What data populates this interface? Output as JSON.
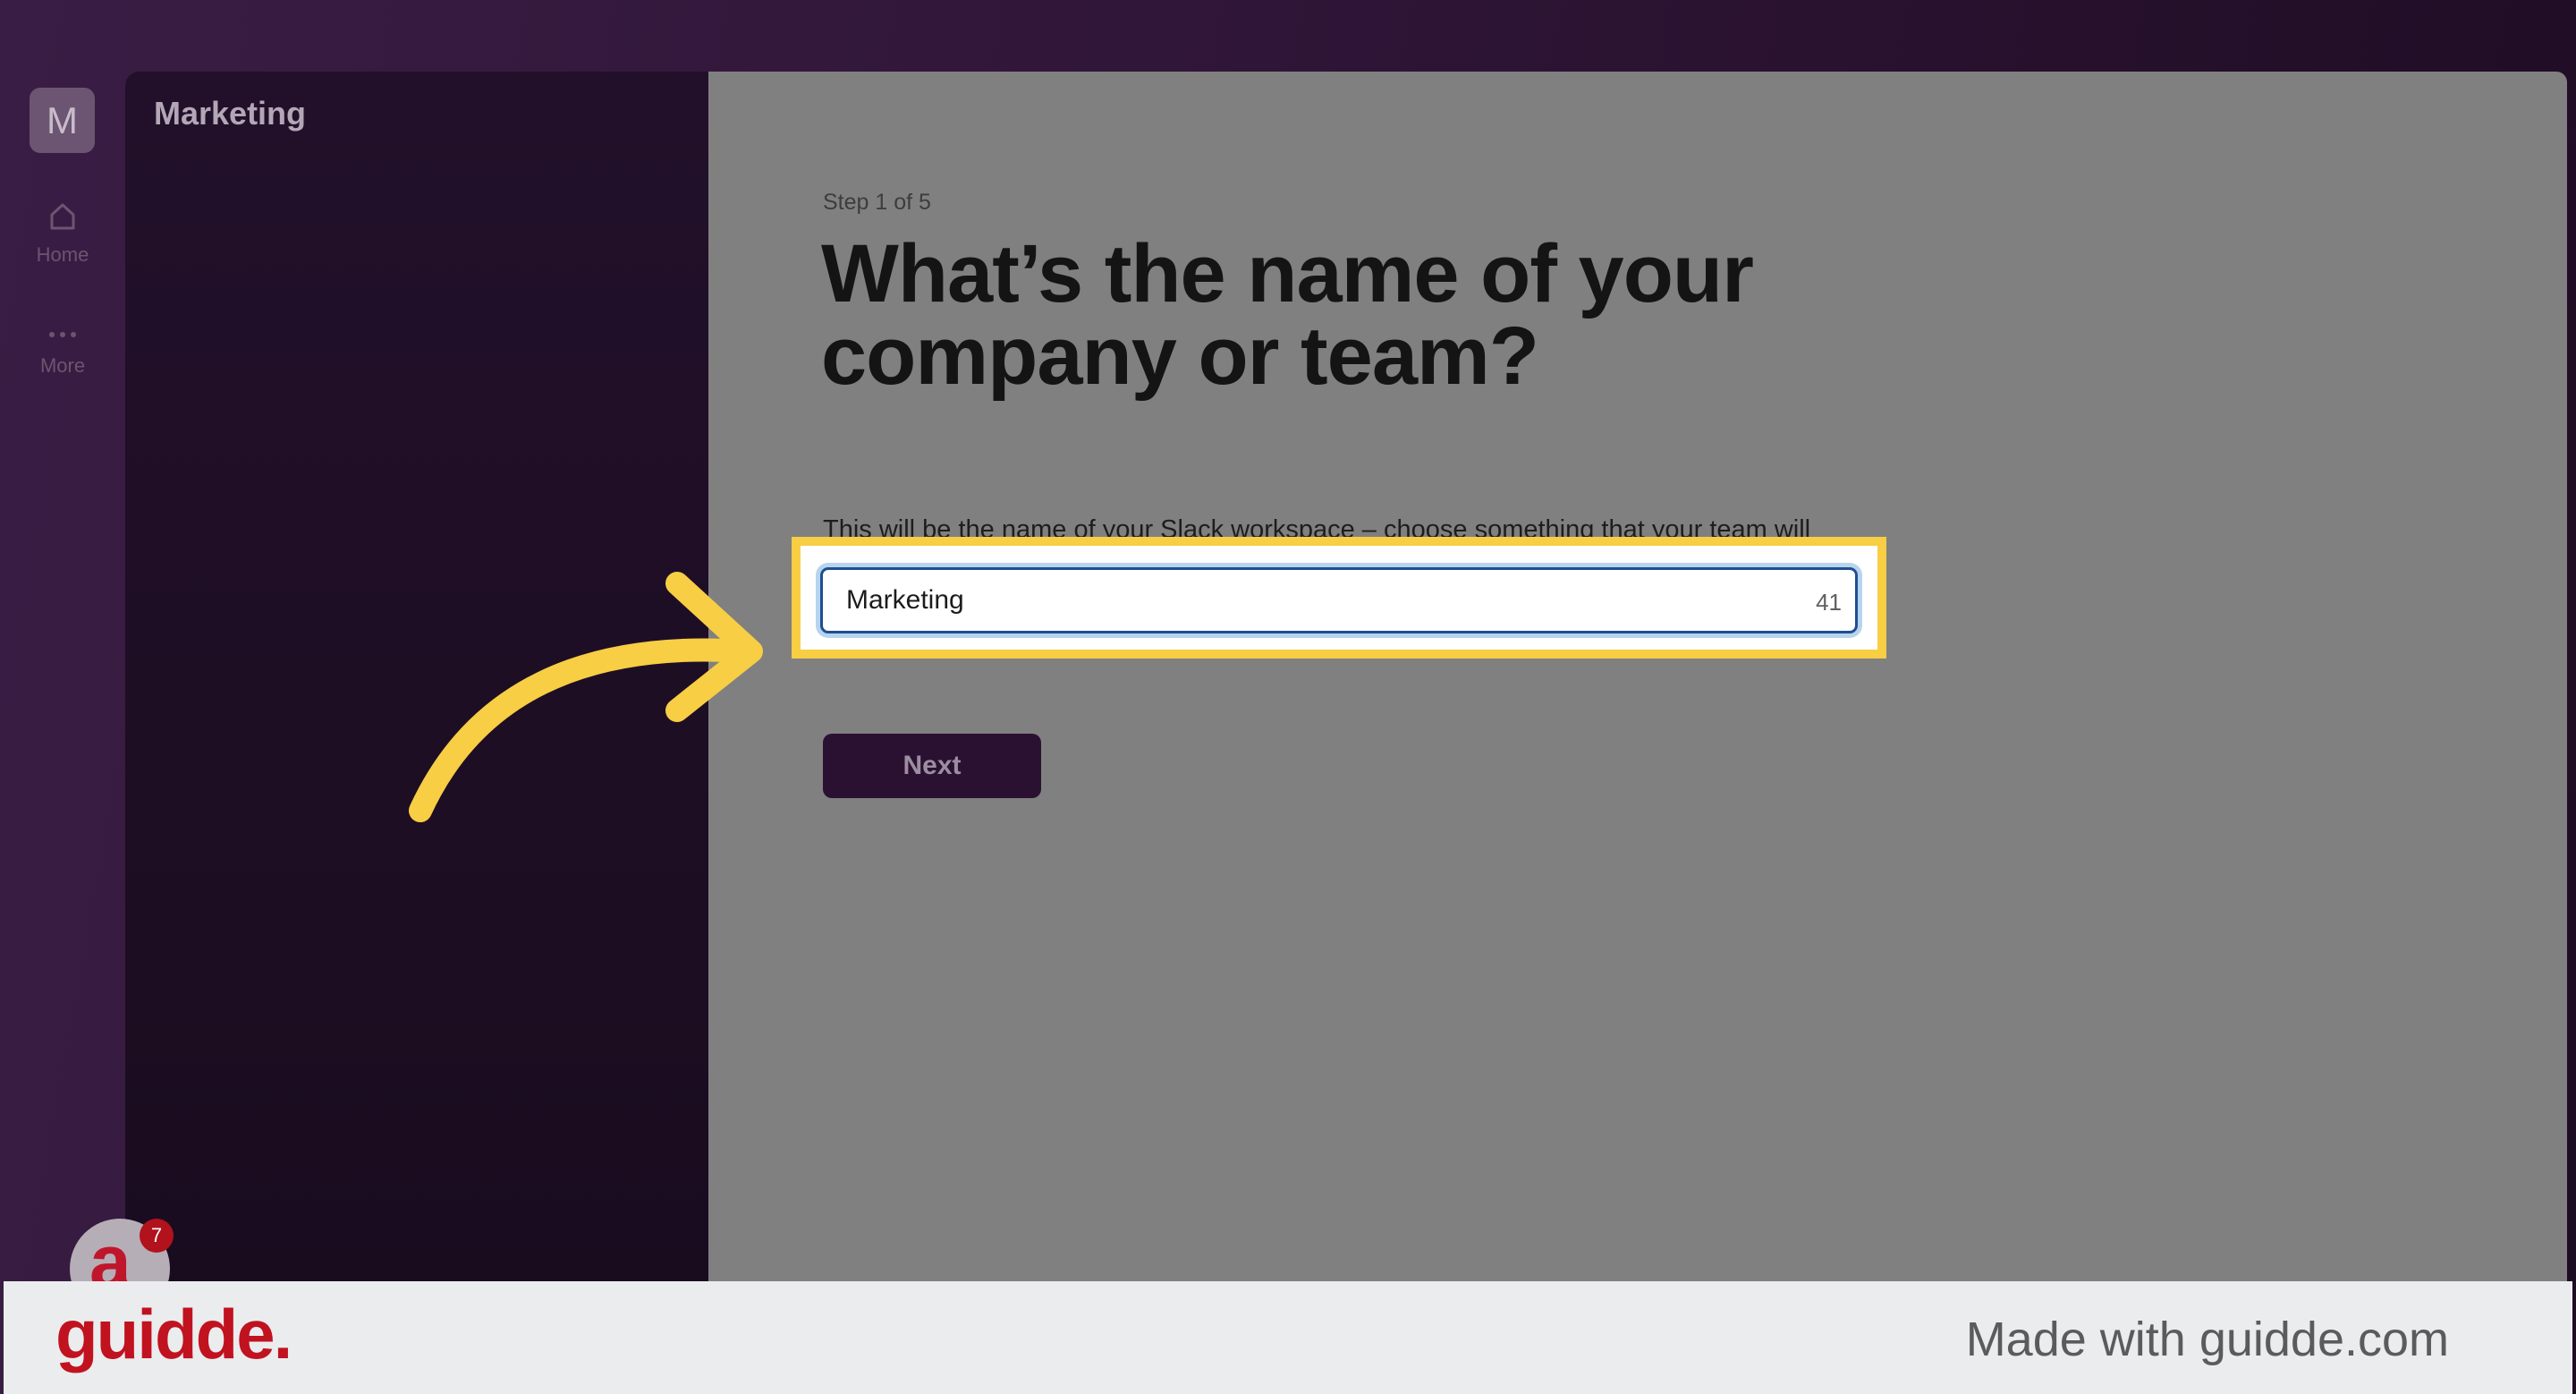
{
  "rail": {
    "workspace_initial": "M",
    "home_label": "Home",
    "more_label": "More"
  },
  "sidebar": {
    "workspace_name": "Marketing"
  },
  "main": {
    "step_label": "Step 1 of 5",
    "headline": "What’s the name of your company or team?",
    "description": "This will be the name of your Slack workspace – choose something that your team will recognise.",
    "input_value": "Marketing",
    "char_count": "41",
    "next_label": "Next"
  },
  "guidde_widget": {
    "avatar_letter": "a",
    "badge_count": "7"
  },
  "footer": {
    "logo_text": "guidde.",
    "made_with": "Made with guidde.com"
  },
  "colors": {
    "highlight": "#f7ce44",
    "annotation_arrow": "#f7ce44",
    "brand_red": "#c1121f",
    "next_button": "#2b1131"
  }
}
